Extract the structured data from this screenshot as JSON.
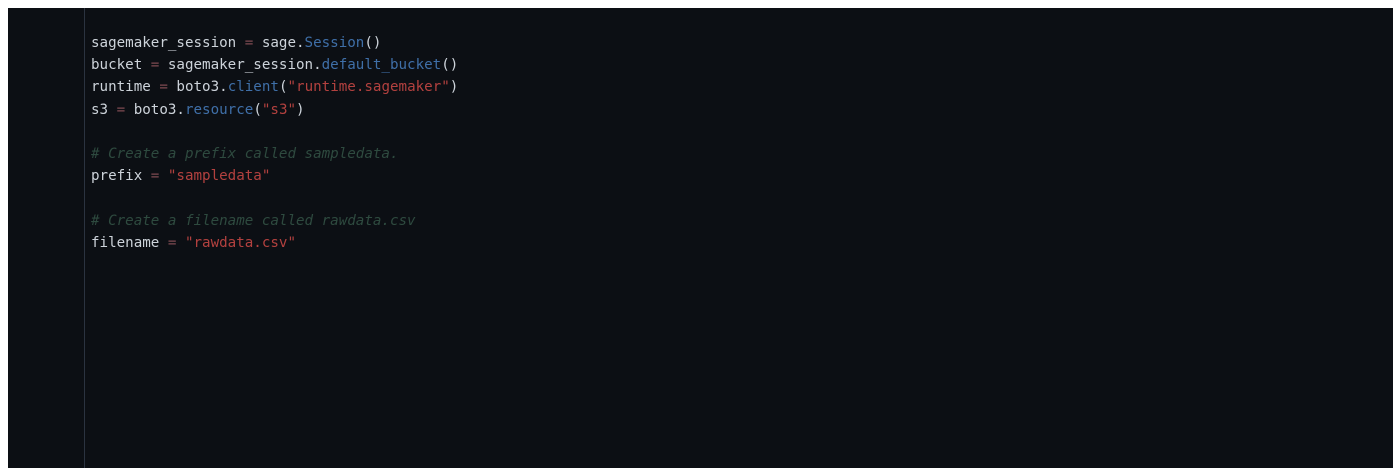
{
  "editor": {
    "colors": {
      "background": "#0c0f14",
      "plain": "#cdd3da",
      "operator": "#7f4a52",
      "function": "#3f6fa8",
      "string": "#b3413f",
      "comment": "#2e4a3f"
    },
    "lines": [
      [
        {
          "type": "plain",
          "text": "sagemaker_session "
        },
        {
          "type": "op",
          "text": "="
        },
        {
          "type": "plain",
          "text": " sage."
        },
        {
          "type": "fn",
          "text": "Session"
        },
        {
          "type": "plain",
          "text": "()"
        }
      ],
      [
        {
          "type": "plain",
          "text": "bucket "
        },
        {
          "type": "op",
          "text": "="
        },
        {
          "type": "plain",
          "text": " sagemaker_session."
        },
        {
          "type": "fn",
          "text": "default_bucket"
        },
        {
          "type": "plain",
          "text": "()"
        }
      ],
      [
        {
          "type": "plain",
          "text": "runtime "
        },
        {
          "type": "op",
          "text": "="
        },
        {
          "type": "plain",
          "text": " boto3."
        },
        {
          "type": "fn",
          "text": "client"
        },
        {
          "type": "plain",
          "text": "("
        },
        {
          "type": "str",
          "text": "\"runtime.sagemaker\""
        },
        {
          "type": "plain",
          "text": ")"
        }
      ],
      [
        {
          "type": "plain",
          "text": "s3 "
        },
        {
          "type": "op",
          "text": "="
        },
        {
          "type": "plain",
          "text": " boto3."
        },
        {
          "type": "fn",
          "text": "resource"
        },
        {
          "type": "plain",
          "text": "("
        },
        {
          "type": "str",
          "text": "\"s3\""
        },
        {
          "type": "plain",
          "text": ")"
        }
      ],
      [],
      [
        {
          "type": "comment",
          "text": "# Create a prefix called sampledata."
        }
      ],
      [
        {
          "type": "plain",
          "text": "prefix "
        },
        {
          "type": "op",
          "text": "="
        },
        {
          "type": "plain",
          "text": " "
        },
        {
          "type": "str",
          "text": "\"sampledata\""
        }
      ],
      [],
      [
        {
          "type": "comment",
          "text": "# Create a filename called rawdata.csv"
        }
      ],
      [
        {
          "type": "plain",
          "text": "filename "
        },
        {
          "type": "op",
          "text": "="
        },
        {
          "type": "plain",
          "text": " "
        },
        {
          "type": "str",
          "text": "\"rawdata.csv\""
        }
      ]
    ]
  }
}
